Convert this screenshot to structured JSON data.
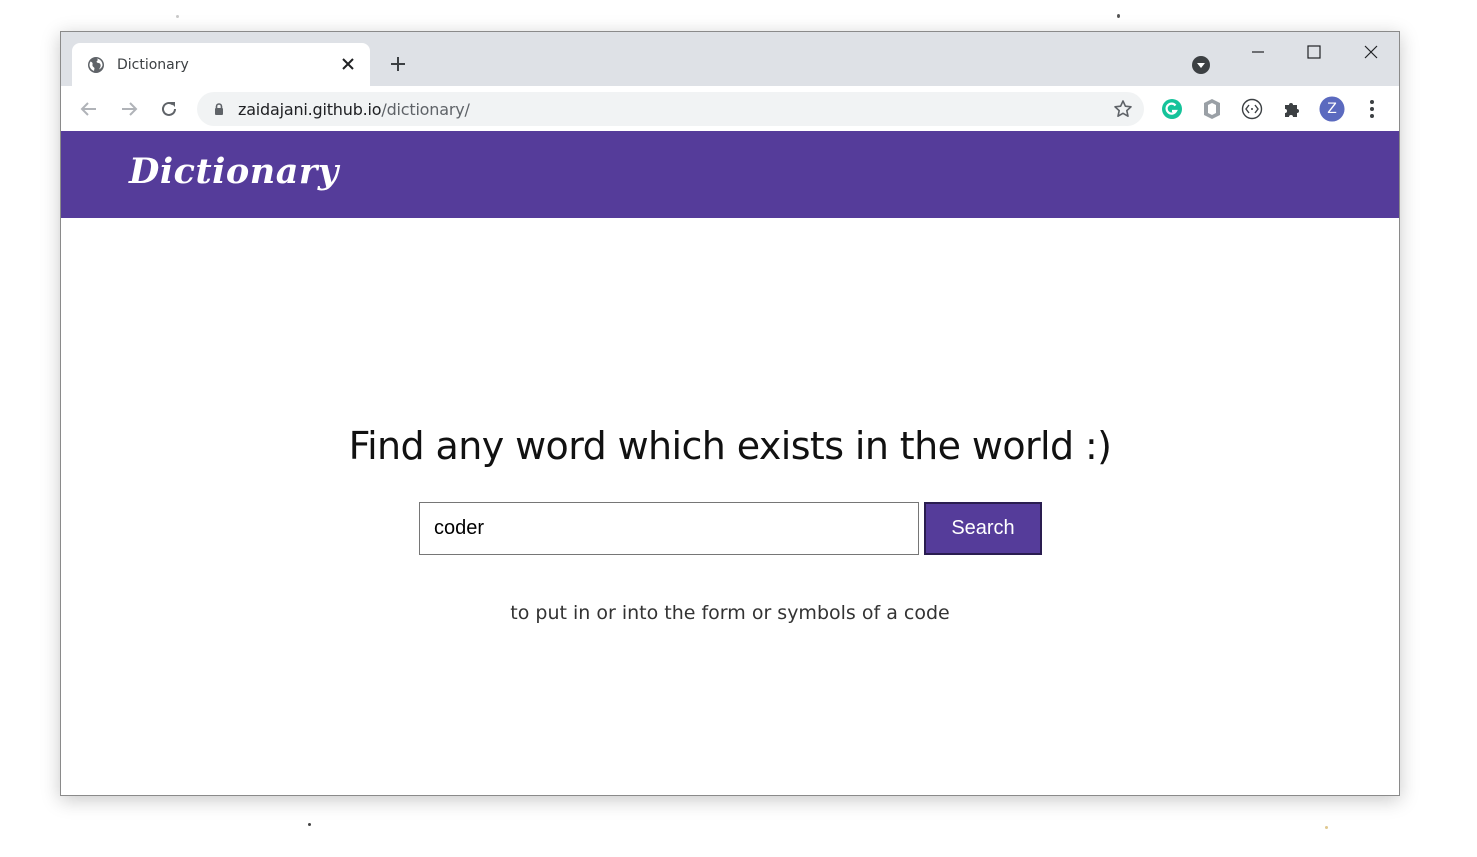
{
  "browser": {
    "tab_title": "Dictionary",
    "url_host": "zaidajani.github.io",
    "url_path": "/dictionary/",
    "profile_initial": "Z",
    "icons": [
      "globe-icon",
      "close-icon",
      "plus-icon",
      "media-control-icon",
      "minimize-icon",
      "maximize-icon",
      "close-window-icon",
      "back-arrow-icon",
      "forward-arrow-icon",
      "reload-icon",
      "lock-icon",
      "star-icon",
      "grammarly-icon",
      "extension-icon",
      "devtools-extension-icon",
      "puzzle-icon",
      "kebab-menu-icon"
    ]
  },
  "site": {
    "logo": "Dictionary",
    "heading": "Find any word which exists in the world :)",
    "search_value": "coder",
    "search_button_label": "Search",
    "definition": "to put in or into the form or symbols of a code"
  },
  "colors": {
    "brand": "#553c9a",
    "grammarly": "#15c39a",
    "avatar": "#5b6abf"
  }
}
